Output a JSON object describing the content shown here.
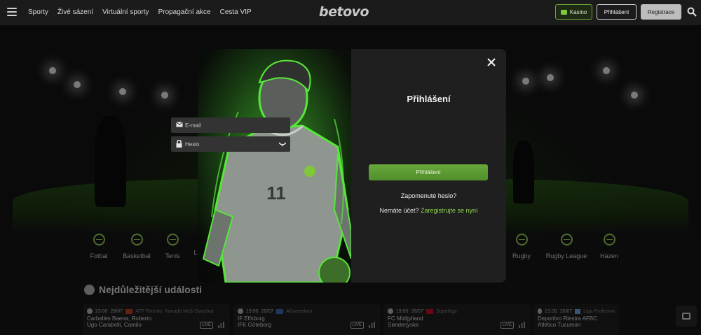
{
  "header": {
    "nav": [
      "Sporty",
      "Živé sázení",
      "Virtuální sporty",
      "Propagační akce",
      "Cesta VIP"
    ],
    "logo": "betovo",
    "kasino_label": "Kasino",
    "login_label": "Přihlášení",
    "register_label": "Registrace"
  },
  "sports": [
    {
      "label": "Fotbal"
    },
    {
      "label": "Basketbal"
    },
    {
      "label": "Tenis"
    },
    {
      "label": "L"
    },
    {
      "label": "Rugby"
    },
    {
      "label": "Rugby League"
    },
    {
      "label": "Házen"
    }
  ],
  "events": {
    "title": "Nejdůležitější události",
    "cards": [
      {
        "time": "23:00",
        "date": "28/07",
        "league": "ATP Toronto, Kanada Muži Dvouhra",
        "team1": "Carballes Baena, Roberto",
        "team2": "Ugo Carabelli, Camilo",
        "live": "LIVE"
      },
      {
        "time": "19:00",
        "date": "28/07",
        "league": "Allsvenskan",
        "team1": "IF Elfsborg",
        "team2": "IFK Göteborg",
        "live": "LIVE"
      },
      {
        "time": "19:00",
        "date": "28/07",
        "league": "Superliga",
        "team1": "FC Midtjylland",
        "team2": "Sønderjyske",
        "live": "LIVE"
      },
      {
        "time": "21:00",
        "date": "28/07",
        "league": "Liga Profesion",
        "team1": "Deportivo Riestra AFBC",
        "team2": "Atlético Tucumán",
        "live": ""
      }
    ]
  },
  "modal": {
    "title": "Přihlášení",
    "email_placeholder": "E-mail",
    "password_placeholder": "Heslo",
    "submit_label": "Přihlášení",
    "forgot_label": "Zapomenuté heslo?",
    "no_account_text": "Nemáte účet?",
    "register_link": "Zaregistrujte se nyní",
    "jersey_number": "11"
  },
  "colors": {
    "accent": "#7ec83a",
    "background": "#161616",
    "panel": "#1f1f1f"
  }
}
